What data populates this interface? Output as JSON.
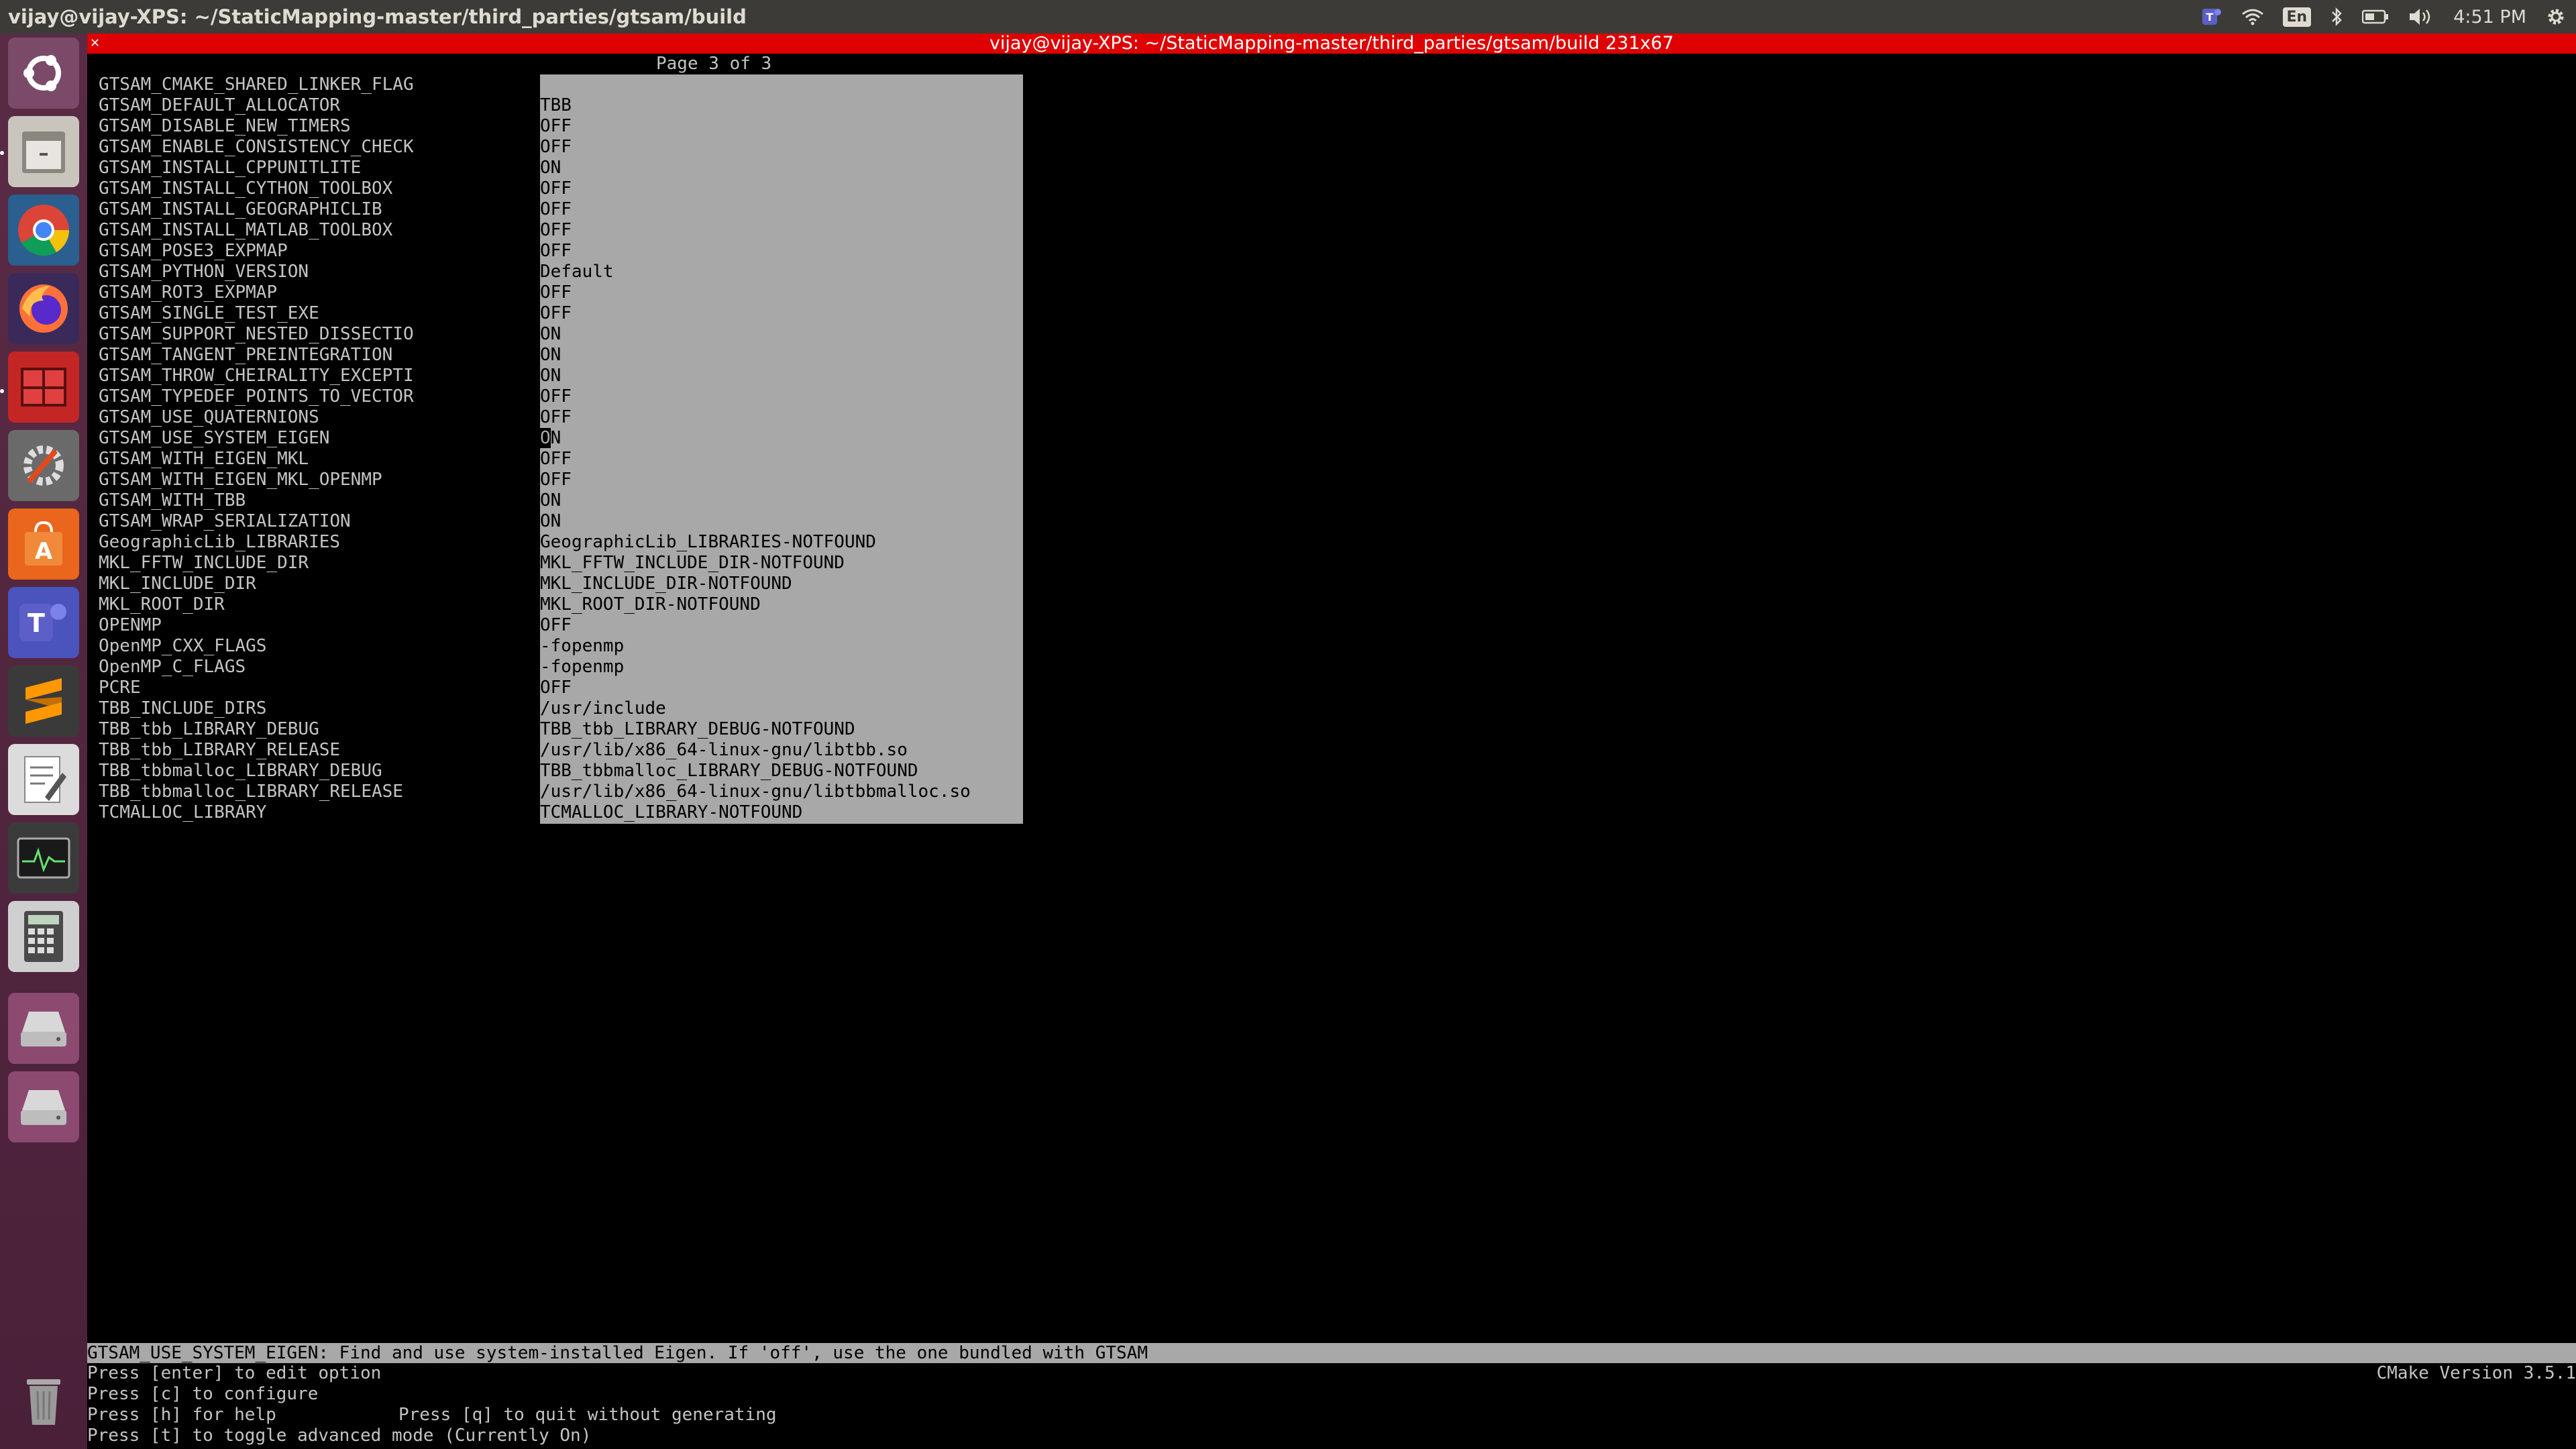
{
  "top_bar": {
    "window_title": "vijay@vijay-XPS: ~/StaticMapping-master/third_parties/gtsam/build",
    "keyboard_layout": "En",
    "clock": "4:51 PM"
  },
  "launcher": {
    "items": [
      {
        "name": "Dash",
        "icon": "ubuntu-logo-icon"
      },
      {
        "name": "Files",
        "icon": "file-cabinet-icon"
      },
      {
        "name": "Google Chrome",
        "icon": "chrome-icon"
      },
      {
        "name": "Firefox",
        "icon": "firefox-icon"
      },
      {
        "name": "Workspace Switcher",
        "icon": "workspace-switcher-icon"
      },
      {
        "name": "System Settings",
        "icon": "settings-tools-icon"
      },
      {
        "name": "Ubuntu Software",
        "icon": "software-center-icon"
      },
      {
        "name": "Microsoft Teams",
        "icon": "teams-icon"
      },
      {
        "name": "Sublime Text",
        "icon": "sublime-text-icon"
      },
      {
        "name": "Text Editor",
        "icon": "text-editor-icon"
      },
      {
        "name": "System Monitor",
        "icon": "system-monitor-icon"
      },
      {
        "name": "Calculator",
        "icon": "calculator-icon"
      },
      {
        "name": "Disk 1",
        "icon": "drive-icon"
      },
      {
        "name": "Disk 2",
        "icon": "drive-icon"
      },
      {
        "name": "Trash",
        "icon": "trash-icon"
      }
    ]
  },
  "terminal": {
    "title": "vijay@vijay-XPS: ~/StaticMapping-master/third_parties/gtsam/build 231x67",
    "page_indicator": "Page 3 of 3",
    "entries": [
      {
        "key": "GTSAM_CMAKE_SHARED_LINKER_FLAG",
        "value": ""
      },
      {
        "key": "GTSAM_DEFAULT_ALLOCATOR",
        "value": "TBB"
      },
      {
        "key": "GTSAM_DISABLE_NEW_TIMERS",
        "value": "OFF"
      },
      {
        "key": "GTSAM_ENABLE_CONSISTENCY_CHECK",
        "value": "OFF"
      },
      {
        "key": "GTSAM_INSTALL_CPPUNITLITE",
        "value": "ON"
      },
      {
        "key": "GTSAM_INSTALL_CYTHON_TOOLBOX",
        "value": "OFF"
      },
      {
        "key": "GTSAM_INSTALL_GEOGRAPHICLIB",
        "value": "OFF"
      },
      {
        "key": "GTSAM_INSTALL_MATLAB_TOOLBOX",
        "value": "OFF"
      },
      {
        "key": "GTSAM_POSE3_EXPMAP",
        "value": "OFF"
      },
      {
        "key": "GTSAM_PYTHON_VERSION",
        "value": "Default"
      },
      {
        "key": "GTSAM_ROT3_EXPMAP",
        "value": "OFF"
      },
      {
        "key": "GTSAM_SINGLE_TEST_EXE",
        "value": "OFF"
      },
      {
        "key": "GTSAM_SUPPORT_NESTED_DISSECTIO",
        "value": "ON"
      },
      {
        "key": "GTSAM_TANGENT_PREINTEGRATION",
        "value": "ON"
      },
      {
        "key": "GTSAM_THROW_CHEIRALITY_EXCEPTI",
        "value": "ON"
      },
      {
        "key": "GTSAM_TYPEDEF_POINTS_TO_VECTOR",
        "value": "OFF"
      },
      {
        "key": "GTSAM_USE_QUATERNIONS",
        "value": "OFF"
      },
      {
        "key": "GTSAM_USE_SYSTEM_EIGEN",
        "value": "ON",
        "selected": true
      },
      {
        "key": "GTSAM_WITH_EIGEN_MKL",
        "value": "OFF"
      },
      {
        "key": "GTSAM_WITH_EIGEN_MKL_OPENMP",
        "value": "OFF"
      },
      {
        "key": "GTSAM_WITH_TBB",
        "value": "ON"
      },
      {
        "key": "GTSAM_WRAP_SERIALIZATION",
        "value": "ON"
      },
      {
        "key": "GeographicLib_LIBRARIES",
        "value": "GeographicLib_LIBRARIES-NOTFOUND"
      },
      {
        "key": "MKL_FFTW_INCLUDE_DIR",
        "value": "MKL_FFTW_INCLUDE_DIR-NOTFOUND"
      },
      {
        "key": "MKL_INCLUDE_DIR",
        "value": "MKL_INCLUDE_DIR-NOTFOUND"
      },
      {
        "key": "MKL_ROOT_DIR",
        "value": "MKL_ROOT_DIR-NOTFOUND"
      },
      {
        "key": "OPENMP",
        "value": "OFF"
      },
      {
        "key": "OpenMP_CXX_FLAGS",
        "value": "-fopenmp"
      },
      {
        "key": "OpenMP_C_FLAGS",
        "value": "-fopenmp"
      },
      {
        "key": "PCRE",
        "value": "OFF"
      },
      {
        "key": "TBB_INCLUDE_DIRS",
        "value": "/usr/include"
      },
      {
        "key": "TBB_tbb_LIBRARY_DEBUG",
        "value": "TBB_tbb_LIBRARY_DEBUG-NOTFOUND"
      },
      {
        "key": "TBB_tbb_LIBRARY_RELEASE",
        "value": "/usr/lib/x86_64-linux-gnu/libtbb.so"
      },
      {
        "key": "TBB_tbbmalloc_LIBRARY_DEBUG",
        "value": "TBB_tbbmalloc_LIBRARY_DEBUG-NOTFOUND"
      },
      {
        "key": "TBB_tbbmalloc_LIBRARY_RELEASE",
        "value": "/usr/lib/x86_64-linux-gnu/libtbbmalloc.so"
      },
      {
        "key": "TCMALLOC_LIBRARY",
        "value": "TCMALLOC_LIBRARY-NOTFOUND"
      }
    ],
    "help_text": "GTSAM_USE_SYSTEM_EIGEN: Find and use system-installed Eigen. If 'off', use the one bundled with GTSAM",
    "instructions": {
      "line1": "Press [enter] to edit option",
      "line2": "Press [c] to configure",
      "line3a": "Press [h] for help",
      "line3b": "Press [q] to quit without generating",
      "line4": "Press [t] to toggle advanced mode (Currently On)"
    },
    "cmake_version": "CMake Version 3.5.1"
  }
}
